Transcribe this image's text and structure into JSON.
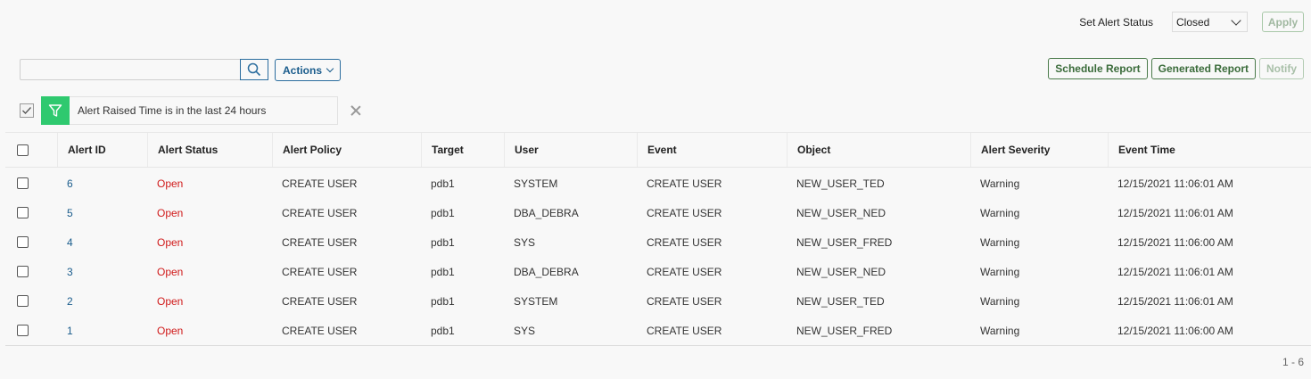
{
  "status_bar": {
    "label": "Set Alert Status",
    "selected": "Closed",
    "apply_label": "Apply"
  },
  "toolbar": {
    "search_placeholder": "",
    "actions_label": "Actions"
  },
  "report_buttons": {
    "schedule": "Schedule Report",
    "generated": "Generated Report",
    "notify": "Notify"
  },
  "filter": {
    "text": "Alert Raised Time is in the last 24 hours"
  },
  "table": {
    "headers": [
      "Alert ID",
      "Alert Status",
      "Alert Policy",
      "Target",
      "User",
      "Event",
      "Object",
      "Alert Severity",
      "Event Time"
    ],
    "rows": [
      [
        "6",
        "Open",
        "CREATE USER",
        "pdb1",
        "SYSTEM",
        "CREATE USER",
        "NEW_USER_TED",
        "Warning",
        "12/15/2021 11:06:01 AM"
      ],
      [
        "5",
        "Open",
        "CREATE USER",
        "pdb1",
        "DBA_DEBRA",
        "CREATE USER",
        "NEW_USER_NED",
        "Warning",
        "12/15/2021 11:06:01 AM"
      ],
      [
        "4",
        "Open",
        "CREATE USER",
        "pdb1",
        "SYS",
        "CREATE USER",
        "NEW_USER_FRED",
        "Warning",
        "12/15/2021 11:06:00 AM"
      ],
      [
        "3",
        "Open",
        "CREATE USER",
        "pdb1",
        "DBA_DEBRA",
        "CREATE USER",
        "NEW_USER_NED",
        "Warning",
        "12/15/2021 11:06:01 AM"
      ],
      [
        "2",
        "Open",
        "CREATE USER",
        "pdb1",
        "SYSTEM",
        "CREATE USER",
        "NEW_USER_TED",
        "Warning",
        "12/15/2021 11:06:01 AM"
      ],
      [
        "1",
        "Open",
        "CREATE USER",
        "pdb1",
        "SYS",
        "CREATE USER",
        "NEW_USER_FRED",
        "Warning",
        "12/15/2021 11:06:00 AM"
      ]
    ]
  },
  "pagination": {
    "range": "1 - 6"
  },
  "colors": {
    "accent_blue": "#1a5c8c",
    "status_open": "#d01a1a",
    "filter_green": "#2fc96f",
    "button_green": "#3a6b3a"
  }
}
